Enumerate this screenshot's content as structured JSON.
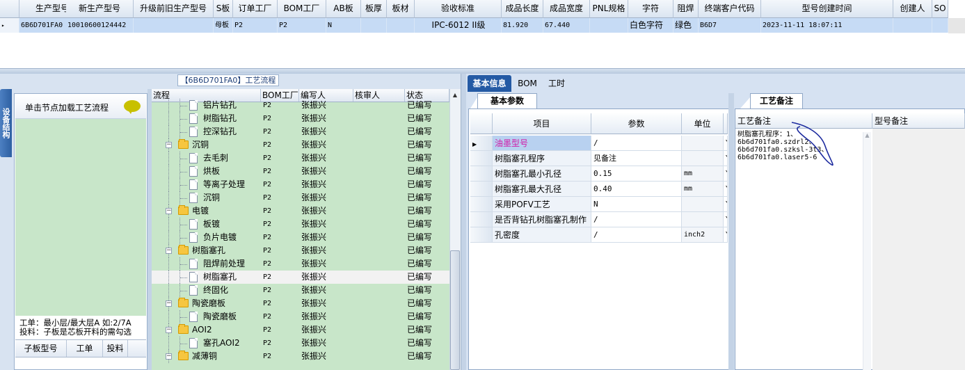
{
  "top_grid": {
    "headers": [
      "生产型号",
      "新生产型号",
      "升级前旧生产型号",
      "S板",
      "订单工厂",
      "BOM工厂",
      "AB板",
      "板厚",
      "板材",
      "验收标准",
      "成品长度",
      "成品宽度",
      "PNL规格",
      "字符",
      "阻焊",
      "终端客户代码",
      "型号创建时间",
      "创建人",
      "SO"
    ],
    "row": [
      "6B6D701FA0",
      "10010600124442",
      "",
      "母板",
      "P2",
      "P2",
      "N",
      "",
      "",
      "IPC-6012 II级",
      "81.920",
      "67.440",
      "",
      "白色字符",
      "绿色",
      "B6D7",
      "2023-11-11 18:07:11",
      "",
      ""
    ],
    "row_marker": "▸"
  },
  "left_panel": {
    "vertical_tab": "设备结构",
    "flow_title": "【6B6D701FA0】工艺流程",
    "hint": "单击节点加载工艺流程",
    "note_line1": "工单：最小层/最大层A 如:2/7A",
    "note_line2": "投料：子板是芯板开料的需勾选",
    "sub_table_headers": [
      "子板型号",
      "工单",
      "投料"
    ]
  },
  "tree": {
    "headers": [
      "流程",
      "BOM工厂",
      "编写人",
      "核审人",
      "状态"
    ],
    "rows": [
      {
        "name": "铝片钻孔",
        "level": 2,
        "bom": "P2",
        "author": "张振兴",
        "status": "已编写"
      },
      {
        "name": "树脂钻孔",
        "level": 2,
        "bom": "P2",
        "author": "张振兴",
        "status": "已编写"
      },
      {
        "name": "控深钻孔",
        "level": 2,
        "bom": "P2",
        "author": "张振兴",
        "status": "已编写"
      },
      {
        "name": "沉铜",
        "level": 1,
        "bom": "P2",
        "author": "张振兴",
        "status": "已编写"
      },
      {
        "name": "去毛刺",
        "level": 2,
        "bom": "P2",
        "author": "张振兴",
        "status": "已编写"
      },
      {
        "name": "烘板",
        "level": 2,
        "bom": "P2",
        "author": "张振兴",
        "status": "已编写"
      },
      {
        "name": "等离子处理",
        "level": 2,
        "bom": "P2",
        "author": "张振兴",
        "status": "已编写"
      },
      {
        "name": "沉铜",
        "level": 2,
        "bom": "P2",
        "author": "张振兴",
        "status": "已编写"
      },
      {
        "name": "电镀",
        "level": 1,
        "bom": "P2",
        "author": "张振兴",
        "status": "已编写"
      },
      {
        "name": "板镀",
        "level": 2,
        "bom": "P2",
        "author": "张振兴",
        "status": "已编写"
      },
      {
        "name": "负片电镀",
        "level": 2,
        "bom": "P2",
        "author": "张振兴",
        "status": "已编写"
      },
      {
        "name": "树脂塞孔",
        "level": 1,
        "bom": "P2",
        "author": "张振兴",
        "status": "已编写"
      },
      {
        "name": "阻焊前处理",
        "level": 2,
        "bom": "P2",
        "author": "张振兴",
        "status": "已编写"
      },
      {
        "name": "树脂塞孔",
        "level": 2,
        "bom": "P2",
        "author": "张振兴",
        "status": "已编写",
        "selected": true
      },
      {
        "name": "终固化",
        "level": 2,
        "bom": "P2",
        "author": "张振兴",
        "status": "已编写"
      },
      {
        "name": "陶瓷磨板",
        "level": 1,
        "bom": "P2",
        "author": "张振兴",
        "status": "已编写"
      },
      {
        "name": "陶瓷磨板",
        "level": 2,
        "bom": "P2",
        "author": "张振兴",
        "status": "已编写"
      },
      {
        "name": "AOI2",
        "level": 1,
        "bom": "P2",
        "author": "张振兴",
        "status": "已编写"
      },
      {
        "name": "塞孔AOI2",
        "level": 2,
        "bom": "P2",
        "author": "张振兴",
        "status": "已编写"
      },
      {
        "name": "减薄铜",
        "level": 1,
        "bom": "P2",
        "author": "张振兴",
        "status": "已编写"
      }
    ]
  },
  "right_tabs": [
    "基本信息",
    "BOM",
    "工时"
  ],
  "basic_params": {
    "sub_tab": "基本参数",
    "headers": [
      "项目",
      "参数",
      "单位"
    ],
    "rows": [
      {
        "item": "油墨型号",
        "value": "/",
        "unit": "",
        "extra": "Y",
        "selected": true
      },
      {
        "item": "树脂塞孔程序",
        "value": "见备注",
        "unit": "",
        "extra": "Y"
      },
      {
        "item": "树脂塞孔最小孔径",
        "value": "0.15",
        "unit": "mm",
        "extra": "Y"
      },
      {
        "item": "树脂塞孔最大孔径",
        "value": "0.40",
        "unit": "mm",
        "extra": "Y"
      },
      {
        "item": "采用POFV工艺",
        "value": "N",
        "unit": "",
        "extra": "Y"
      },
      {
        "item": "是否背钻孔树脂塞孔制作",
        "value": "/",
        "unit": "",
        "extra": "Y"
      },
      {
        "item": "孔密度",
        "value": "/",
        "unit": "inch2",
        "extra": "Y"
      }
    ]
  },
  "process_note": {
    "tab": "工艺备注",
    "headers": [
      "工艺备注",
      "型号备注"
    ],
    "text": "树脂塞孔程序：1、\n6b6d701fa0.szdrl2、\n6b6d701fa0.szksl-3t3、\n6b6d701fa0.laser5-6"
  },
  "colors": {
    "selected_row": "#c6dbf5",
    "tree_green": "#c8e6c9",
    "active_tab": "#245aa4",
    "selected_text": "#d01ca8"
  }
}
